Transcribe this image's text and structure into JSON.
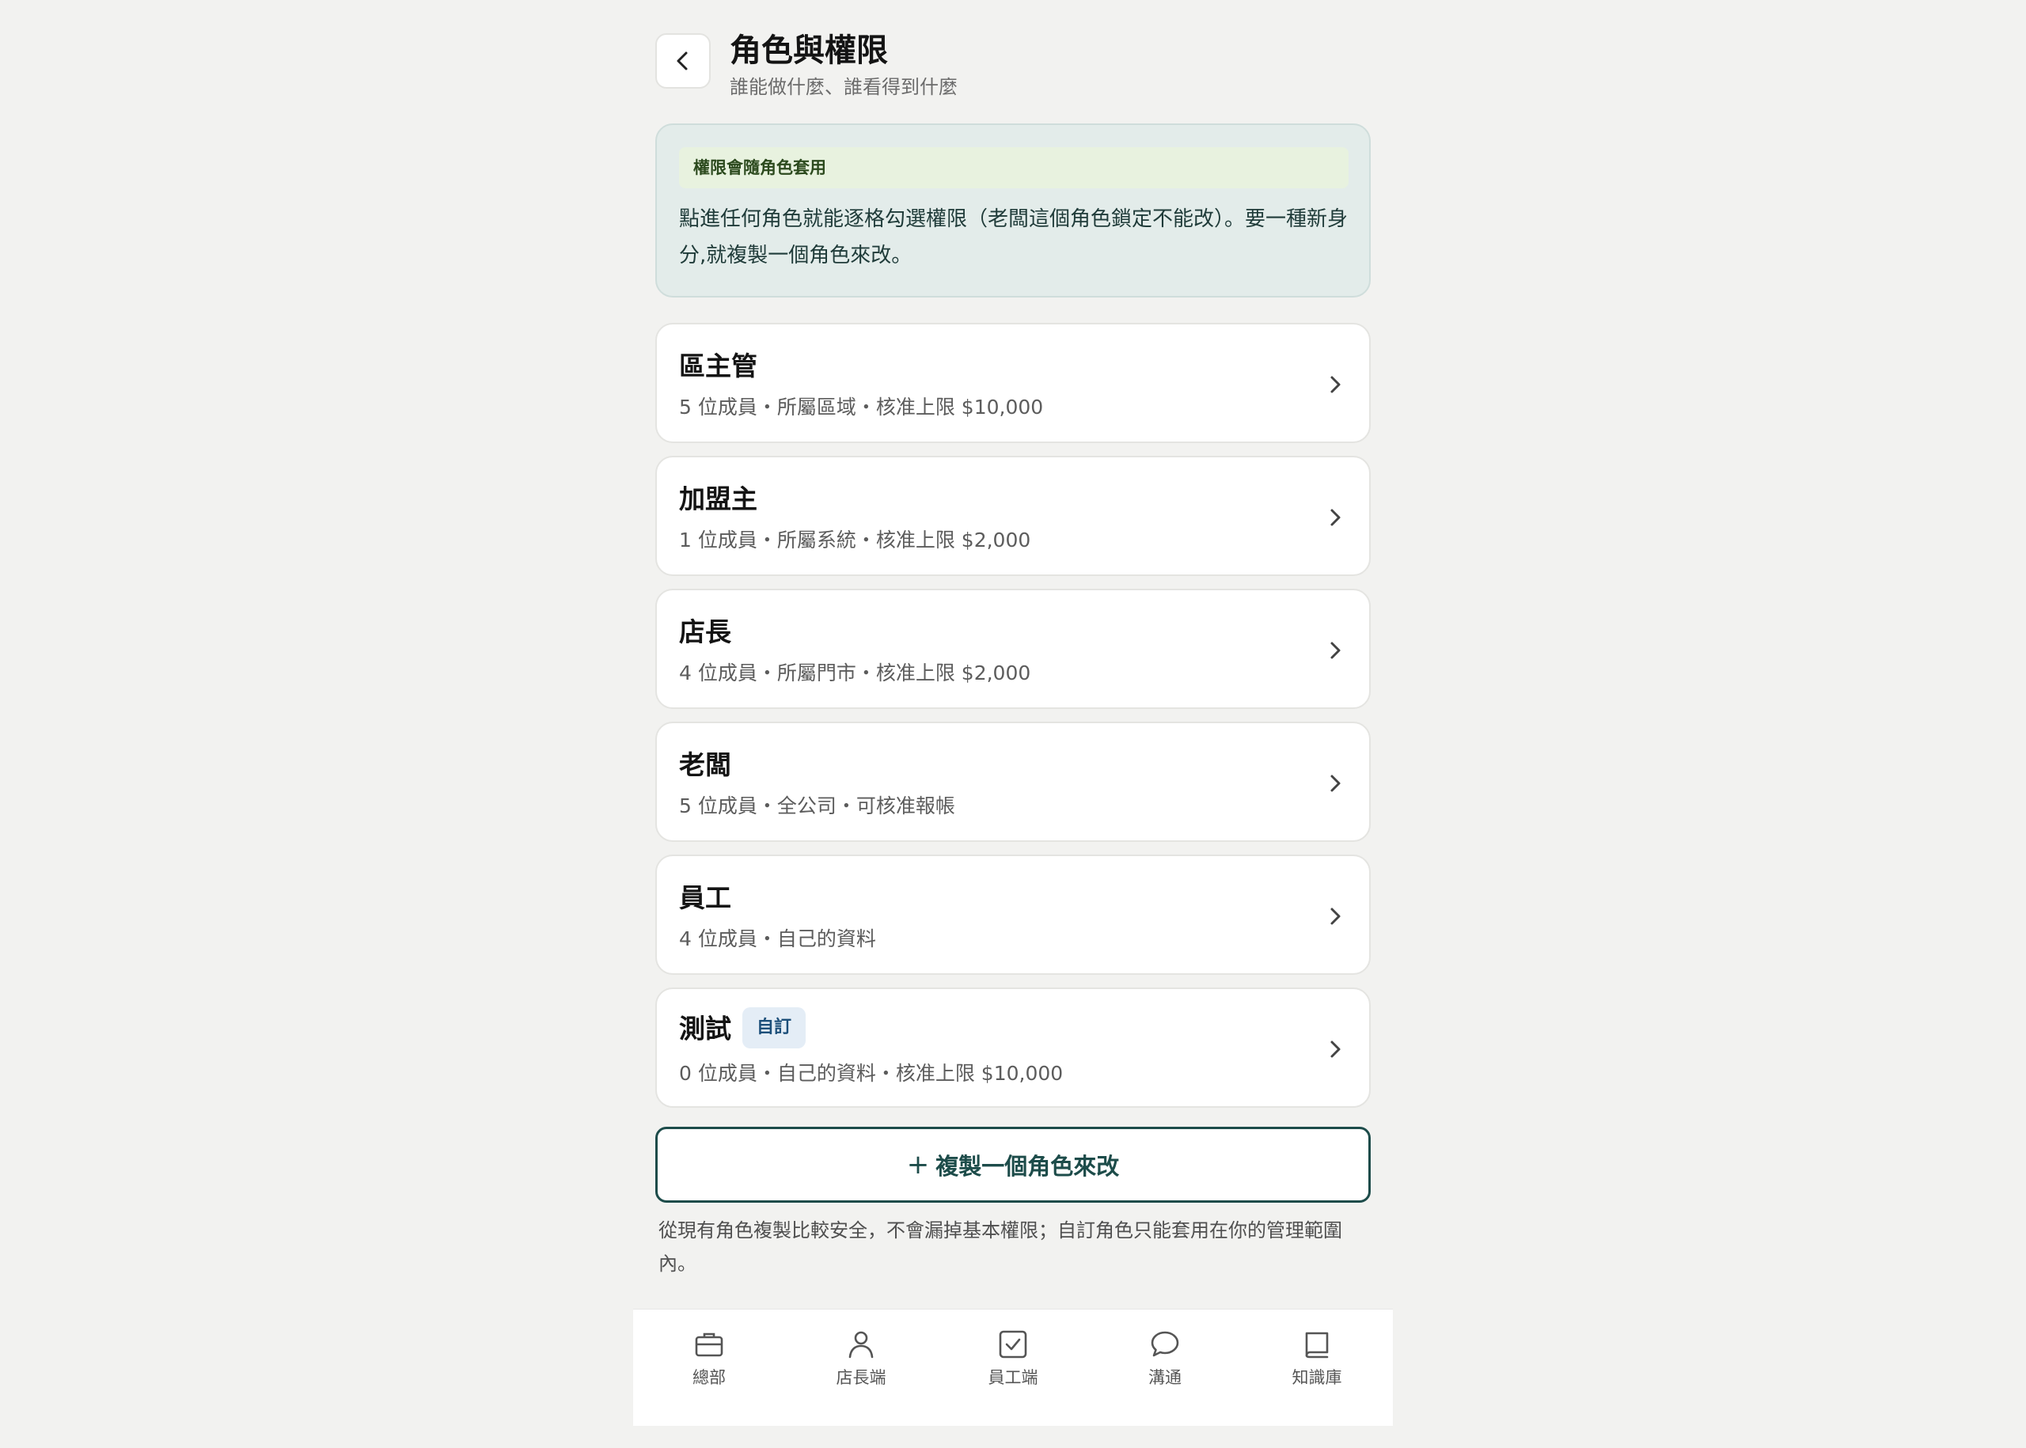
{
  "header": {
    "title": "角色與權限",
    "subtitle": "誰能做什麼、誰看得到什麼"
  },
  "info": {
    "tag": "權限會隨角色套用",
    "text": "點進任何角色就能逐格勾選權限（老闆這個角色鎖定不能改）。要一種新身分,就複製一個角色來改。"
  },
  "roles": [
    {
      "name": "區主管",
      "meta": "5 位成員・所屬區域・核准上限 $10,000"
    },
    {
      "name": "加盟主",
      "meta": "1 位成員・所屬系統・核准上限 $2,000"
    },
    {
      "name": "店長",
      "meta": "4 位成員・所屬門市・核准上限 $2,000"
    },
    {
      "name": "老闆",
      "meta": "5 位成員・全公司・可核准報帳"
    },
    {
      "name": "員工",
      "meta": "4 位成員・自己的資料"
    },
    {
      "name": "測試",
      "badge": "自訂",
      "meta": "0 位成員・自己的資料・核准上限 $10,000"
    }
  ],
  "actions": {
    "copy_label": "複製一個角色來改",
    "copy_plus": "+"
  },
  "footnote": "從現有角色複製比較安全，不會漏掉基本權限；自訂角色只能套用在你的管理範圍內。",
  "tabs": [
    {
      "label": "總部",
      "icon": "briefcase-icon"
    },
    {
      "label": "店長端",
      "icon": "person-icon"
    },
    {
      "label": "員工端",
      "icon": "checkbox-icon"
    },
    {
      "label": "溝通",
      "icon": "chat-bubble-icon"
    },
    {
      "label": "知識庫",
      "icon": "book-icon"
    }
  ]
}
